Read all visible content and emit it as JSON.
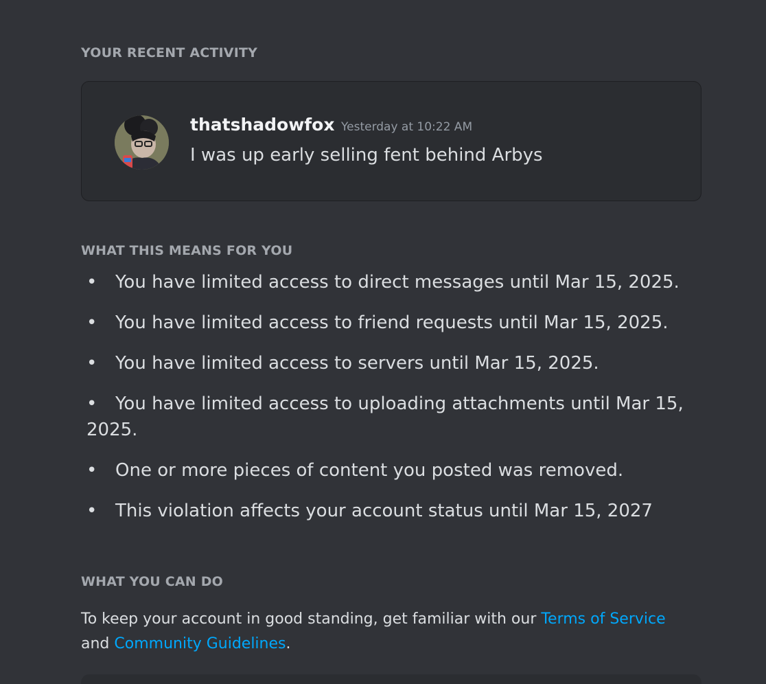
{
  "recent_activity": {
    "heading": "YOUR RECENT ACTIVITY",
    "message": {
      "username": "thatshadowfox",
      "timestamp": "Yesterday at 10:22 AM",
      "text": "I was up early selling fent behind Arbys"
    }
  },
  "consequences": {
    "heading": "WHAT THIS MEANS FOR YOU",
    "items": [
      "You have limited access to direct messages until Mar 15, 2025.",
      "You have limited access to friend requests until Mar 15, 2025.",
      "You have limited access to servers until Mar 15, 2025.",
      "You have limited access to uploading attachments until Mar 15, 2025.",
      "One or more pieces of content you posted was removed.",
      "This violation affects your account status until Mar 15, 2027"
    ]
  },
  "what_you_can_do": {
    "heading": "WHAT YOU CAN DO",
    "text_before": "To keep your account in good standing, get familiar with our ",
    "terms_link": "Terms of Service",
    "text_middle": " and ",
    "guidelines_link": "Community Guidelines",
    "text_after": "."
  },
  "colors": {
    "background": "#313338",
    "card": "#2b2d31",
    "link": "#00a8fc",
    "heading": "#a4a8ae"
  }
}
